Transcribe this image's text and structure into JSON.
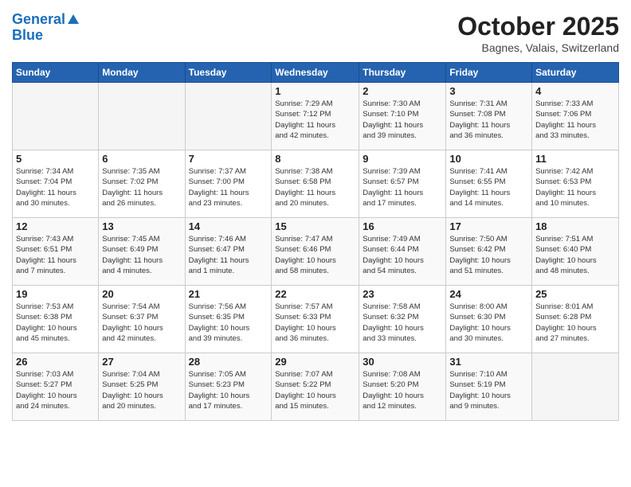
{
  "header": {
    "logo_line1": "General",
    "logo_line2": "Blue",
    "month": "October 2025",
    "location": "Bagnes, Valais, Switzerland"
  },
  "weekdays": [
    "Sunday",
    "Monday",
    "Tuesday",
    "Wednesday",
    "Thursday",
    "Friday",
    "Saturday"
  ],
  "weeks": [
    [
      {
        "day": "",
        "info": ""
      },
      {
        "day": "",
        "info": ""
      },
      {
        "day": "",
        "info": ""
      },
      {
        "day": "1",
        "info": "Sunrise: 7:29 AM\nSunset: 7:12 PM\nDaylight: 11 hours\nand 42 minutes."
      },
      {
        "day": "2",
        "info": "Sunrise: 7:30 AM\nSunset: 7:10 PM\nDaylight: 11 hours\nand 39 minutes."
      },
      {
        "day": "3",
        "info": "Sunrise: 7:31 AM\nSunset: 7:08 PM\nDaylight: 11 hours\nand 36 minutes."
      },
      {
        "day": "4",
        "info": "Sunrise: 7:33 AM\nSunset: 7:06 PM\nDaylight: 11 hours\nand 33 minutes."
      }
    ],
    [
      {
        "day": "5",
        "info": "Sunrise: 7:34 AM\nSunset: 7:04 PM\nDaylight: 11 hours\nand 30 minutes."
      },
      {
        "day": "6",
        "info": "Sunrise: 7:35 AM\nSunset: 7:02 PM\nDaylight: 11 hours\nand 26 minutes."
      },
      {
        "day": "7",
        "info": "Sunrise: 7:37 AM\nSunset: 7:00 PM\nDaylight: 11 hours\nand 23 minutes."
      },
      {
        "day": "8",
        "info": "Sunrise: 7:38 AM\nSunset: 6:58 PM\nDaylight: 11 hours\nand 20 minutes."
      },
      {
        "day": "9",
        "info": "Sunrise: 7:39 AM\nSunset: 6:57 PM\nDaylight: 11 hours\nand 17 minutes."
      },
      {
        "day": "10",
        "info": "Sunrise: 7:41 AM\nSunset: 6:55 PM\nDaylight: 11 hours\nand 14 minutes."
      },
      {
        "day": "11",
        "info": "Sunrise: 7:42 AM\nSunset: 6:53 PM\nDaylight: 11 hours\nand 10 minutes."
      }
    ],
    [
      {
        "day": "12",
        "info": "Sunrise: 7:43 AM\nSunset: 6:51 PM\nDaylight: 11 hours\nand 7 minutes."
      },
      {
        "day": "13",
        "info": "Sunrise: 7:45 AM\nSunset: 6:49 PM\nDaylight: 11 hours\nand 4 minutes."
      },
      {
        "day": "14",
        "info": "Sunrise: 7:46 AM\nSunset: 6:47 PM\nDaylight: 11 hours\nand 1 minute."
      },
      {
        "day": "15",
        "info": "Sunrise: 7:47 AM\nSunset: 6:46 PM\nDaylight: 10 hours\nand 58 minutes."
      },
      {
        "day": "16",
        "info": "Sunrise: 7:49 AM\nSunset: 6:44 PM\nDaylight: 10 hours\nand 54 minutes."
      },
      {
        "day": "17",
        "info": "Sunrise: 7:50 AM\nSunset: 6:42 PM\nDaylight: 10 hours\nand 51 minutes."
      },
      {
        "day": "18",
        "info": "Sunrise: 7:51 AM\nSunset: 6:40 PM\nDaylight: 10 hours\nand 48 minutes."
      }
    ],
    [
      {
        "day": "19",
        "info": "Sunrise: 7:53 AM\nSunset: 6:38 PM\nDaylight: 10 hours\nand 45 minutes."
      },
      {
        "day": "20",
        "info": "Sunrise: 7:54 AM\nSunset: 6:37 PM\nDaylight: 10 hours\nand 42 minutes."
      },
      {
        "day": "21",
        "info": "Sunrise: 7:56 AM\nSunset: 6:35 PM\nDaylight: 10 hours\nand 39 minutes."
      },
      {
        "day": "22",
        "info": "Sunrise: 7:57 AM\nSunset: 6:33 PM\nDaylight: 10 hours\nand 36 minutes."
      },
      {
        "day": "23",
        "info": "Sunrise: 7:58 AM\nSunset: 6:32 PM\nDaylight: 10 hours\nand 33 minutes."
      },
      {
        "day": "24",
        "info": "Sunrise: 8:00 AM\nSunset: 6:30 PM\nDaylight: 10 hours\nand 30 minutes."
      },
      {
        "day": "25",
        "info": "Sunrise: 8:01 AM\nSunset: 6:28 PM\nDaylight: 10 hours\nand 27 minutes."
      }
    ],
    [
      {
        "day": "26",
        "info": "Sunrise: 7:03 AM\nSunset: 5:27 PM\nDaylight: 10 hours\nand 24 minutes."
      },
      {
        "day": "27",
        "info": "Sunrise: 7:04 AM\nSunset: 5:25 PM\nDaylight: 10 hours\nand 20 minutes."
      },
      {
        "day": "28",
        "info": "Sunrise: 7:05 AM\nSunset: 5:23 PM\nDaylight: 10 hours\nand 17 minutes."
      },
      {
        "day": "29",
        "info": "Sunrise: 7:07 AM\nSunset: 5:22 PM\nDaylight: 10 hours\nand 15 minutes."
      },
      {
        "day": "30",
        "info": "Sunrise: 7:08 AM\nSunset: 5:20 PM\nDaylight: 10 hours\nand 12 minutes."
      },
      {
        "day": "31",
        "info": "Sunrise: 7:10 AM\nSunset: 5:19 PM\nDaylight: 10 hours\nand 9 minutes."
      },
      {
        "day": "",
        "info": ""
      }
    ]
  ]
}
